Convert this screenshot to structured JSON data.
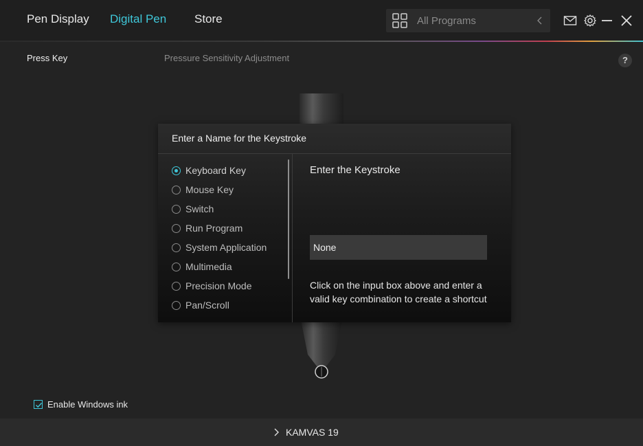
{
  "nav": {
    "tabs": [
      {
        "label": "Pen Display"
      },
      {
        "label": "Digital Pen"
      },
      {
        "label": "Store"
      }
    ],
    "active_tab": "Digital Pen",
    "program_select": {
      "value": "All Programs",
      "icon": "grid-icon"
    },
    "icons": [
      "mail-icon",
      "gear-icon",
      "minimize-icon",
      "close-icon"
    ]
  },
  "subnav": {
    "press_key": "Press Key",
    "pressure": "Pressure Sensitivity Adjustment",
    "help": "?"
  },
  "dialog": {
    "title": "Enter a Name for the Keystroke",
    "options": [
      {
        "label": "Keyboard Key",
        "selected": true
      },
      {
        "label": "Mouse Key",
        "selected": false
      },
      {
        "label": "Switch",
        "selected": false
      },
      {
        "label": "Run Program",
        "selected": false
      },
      {
        "label": "System Application",
        "selected": false
      },
      {
        "label": "Multimedia",
        "selected": false
      },
      {
        "label": "Precision Mode",
        "selected": false
      },
      {
        "label": "Pan/Scroll",
        "selected": false
      }
    ],
    "keystroke_label": "Enter the Keystroke",
    "keystroke_value": "None",
    "keystroke_help": "Click on the input box above and enter a valid key combination to create a shortcut"
  },
  "windows_ink": {
    "label": "Enable Windows ink",
    "checked": true
  },
  "footer": {
    "device": "KAMVAS 19"
  },
  "colors": {
    "accent": "#3fc7d9",
    "background": "#222222"
  }
}
